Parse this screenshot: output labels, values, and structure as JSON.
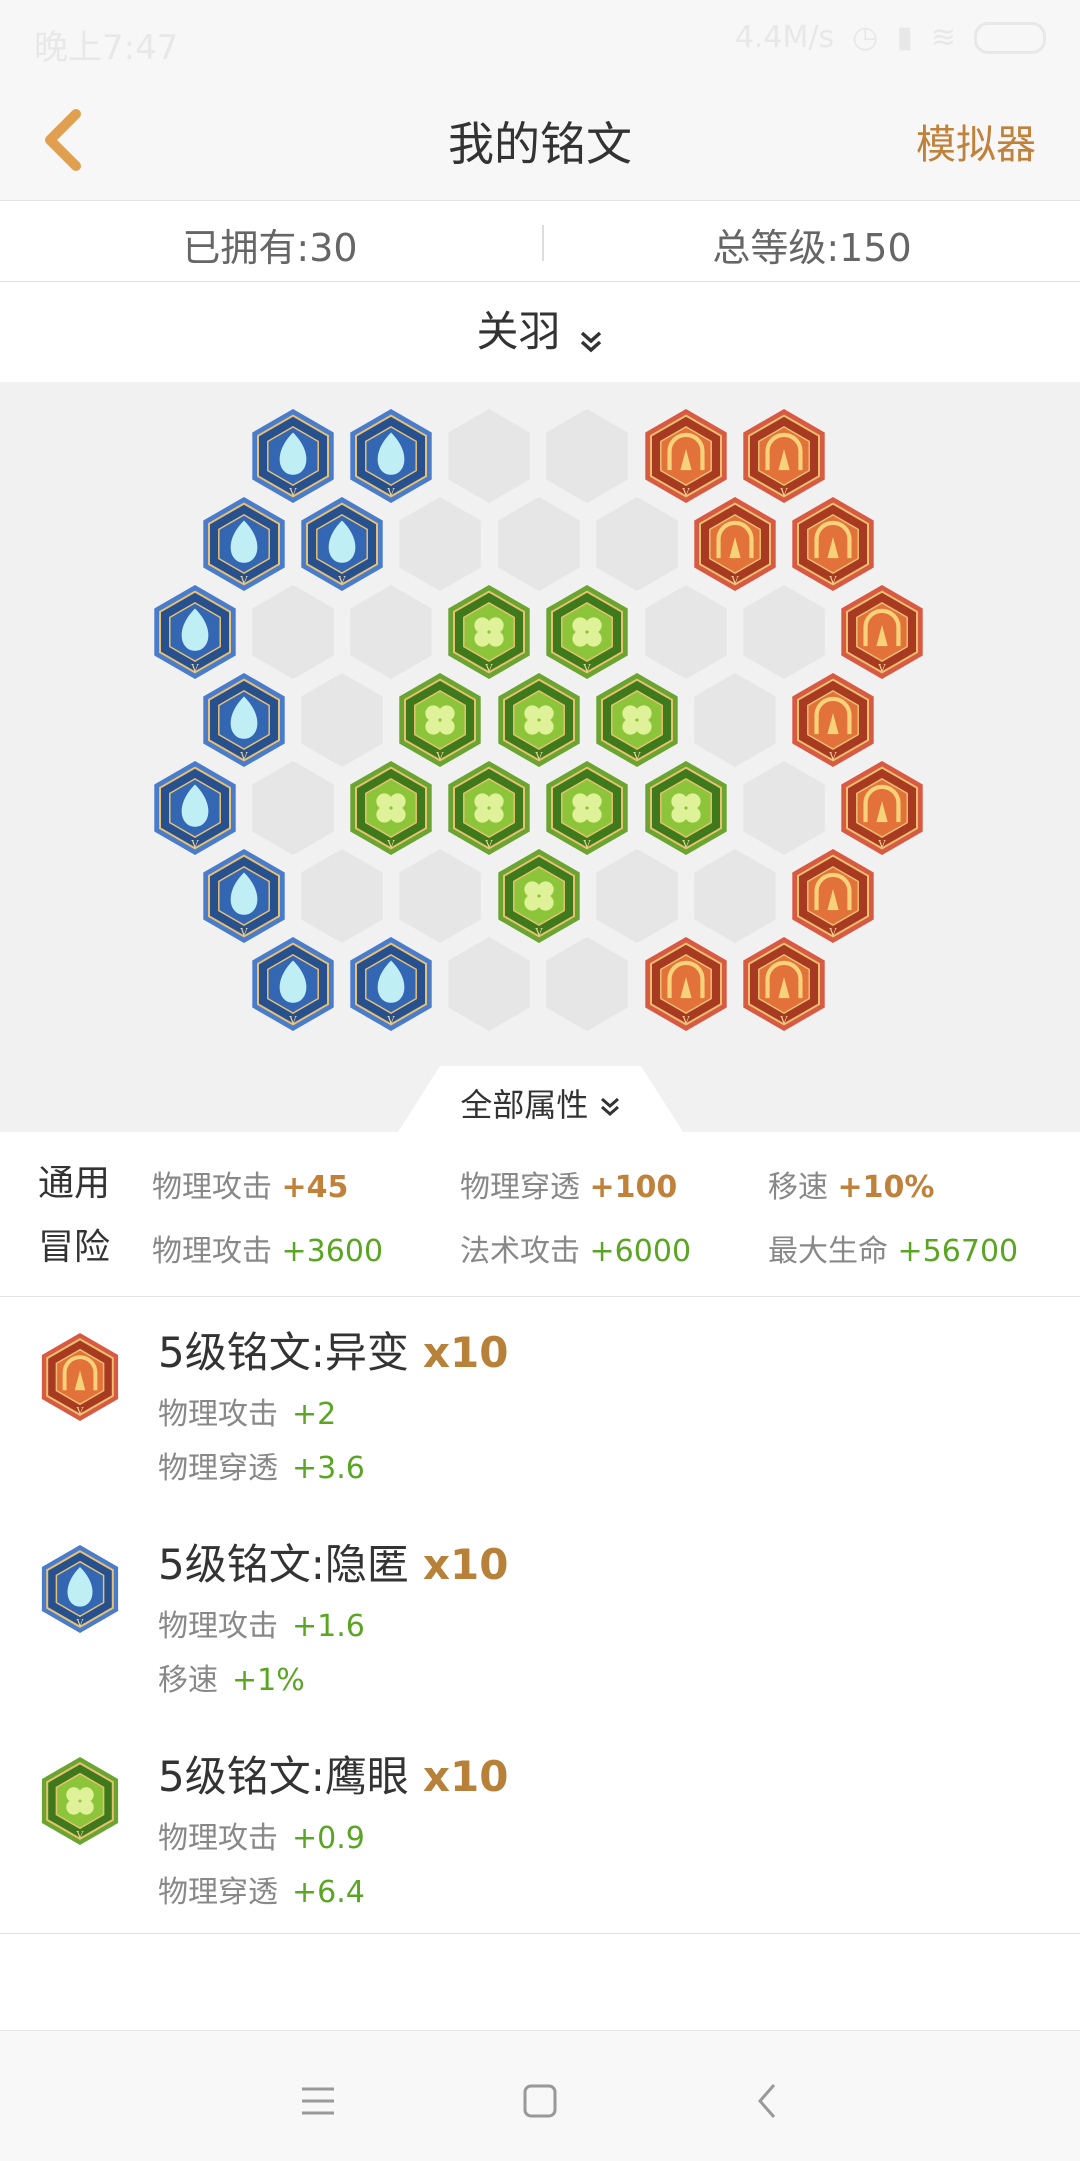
{
  "status_bar": {
    "time": "晚上7:47",
    "speed": "4.4M/s"
  },
  "nav": {
    "title": "我的铭文",
    "simulator_label": "模拟器",
    "back_icon": "chevron-left-icon"
  },
  "stats": {
    "owned": "已拥有:30",
    "total_level": "总等级:150"
  },
  "hero": {
    "name": "关羽",
    "dropdown_icon": "double-chevron-down-icon"
  },
  "colors": {
    "accent": "#c0823b",
    "green_value": "#5aa523",
    "blue_rune": "#3f6fb8",
    "red_rune": "#d04a35",
    "green_rune": "#5aa523"
  },
  "all_attrs_tab": {
    "label": "全部属性"
  },
  "summary": {
    "general": {
      "label": "通用",
      "items": [
        {
          "name": "物理攻击",
          "value": "+45"
        },
        {
          "name": "物理穿透",
          "value": "+100"
        },
        {
          "name": "移速",
          "value": "+10%"
        }
      ]
    },
    "adventure": {
      "label": "冒险",
      "items": [
        {
          "name": "物理攻击",
          "value": "+3600"
        },
        {
          "name": "法术攻击",
          "value": "+6000"
        },
        {
          "name": "最大生命",
          "value": "+56700"
        }
      ]
    }
  },
  "runes": [
    {
      "title": "5级铭文:异变",
      "count": "x10",
      "color": "red",
      "stats": [
        {
          "name": "物理攻击",
          "value": "+2"
        },
        {
          "name": "物理穿透",
          "value": "+3.6"
        }
      ]
    },
    {
      "title": "5级铭文:隐匿",
      "count": "x10",
      "color": "blue",
      "stats": [
        {
          "name": "物理攻击",
          "value": "+1.6"
        },
        {
          "name": "移速",
          "value": "+1%"
        }
      ]
    },
    {
      "title": "5级铭文:鹰眼",
      "count": "x10",
      "color": "green",
      "stats": [
        {
          "name": "物理攻击",
          "value": "+0.9"
        },
        {
          "name": "物理穿透",
          "value": "+6.4"
        }
      ]
    }
  ],
  "bottom_nav": {
    "menu_icon": "menu-icon",
    "home_icon": "square-home-icon",
    "back_icon": "back-arrow-icon"
  }
}
